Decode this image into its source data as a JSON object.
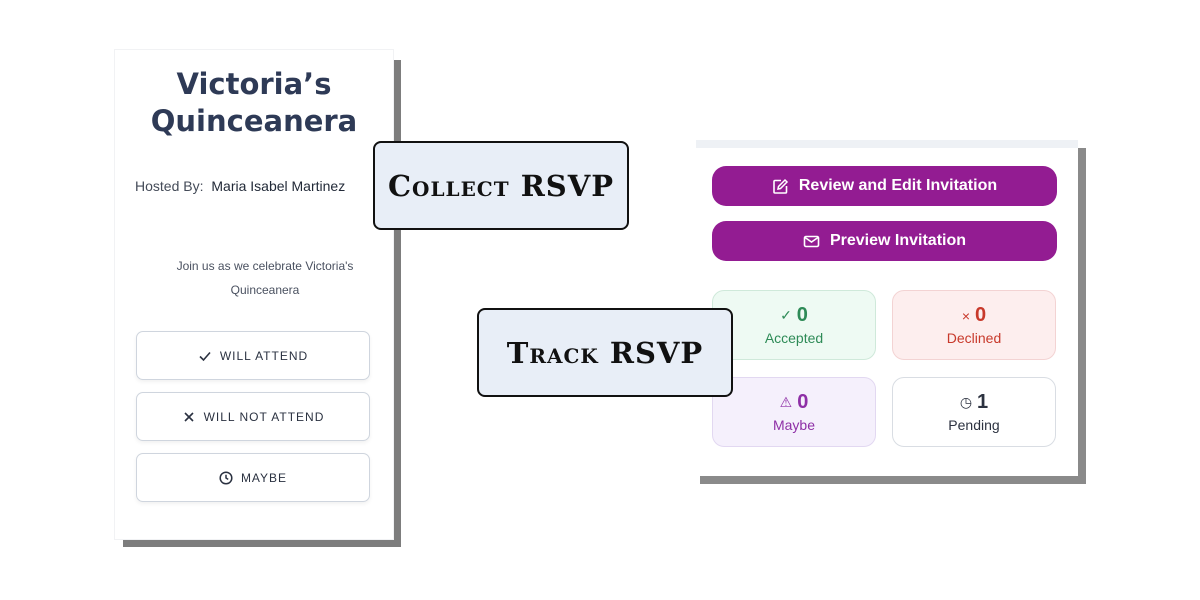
{
  "invitation": {
    "title": "Victoria’s\nQuinceanera",
    "hosted_by_label": "Hosted By:",
    "host_name": "Maria Isabel Martinez",
    "message": "Join us as we celebrate Victoria's Quinceanera",
    "buttons": [
      {
        "label": "WILL ATTEND",
        "icon": "check-icon"
      },
      {
        "label": "WILL NOT ATTEND",
        "icon": "x-icon"
      },
      {
        "label": "MAYBE",
        "icon": "clock-icon"
      }
    ]
  },
  "labels": {
    "collect": "Collect RSVP",
    "track": "Track RSVP"
  },
  "dashboard": {
    "actions": [
      {
        "label": "Review and Edit Invitation",
        "icon": "edit-icon"
      },
      {
        "label": "Preview Invitation",
        "icon": "mail-icon"
      }
    ],
    "stats": [
      {
        "symbol": "✓",
        "count": "0",
        "label": "Accepted",
        "icon": "check-icon",
        "color": "#2e8b57",
        "bg": "#eefaf3",
        "border": "#cfe9da"
      },
      {
        "symbol": "×",
        "count": "0",
        "label": "Declined",
        "icon": "x-icon",
        "color": "#c8392b",
        "bg": "#fdeeee",
        "border": "#f3d3d3"
      },
      {
        "symbol": "⚠",
        "count": "0",
        "label": "Maybe",
        "icon": "warning-icon",
        "color": "#8e2fa6",
        "bg": "#f5f0fc",
        "border": "#e2d8f1"
      },
      {
        "symbol": "◷",
        "count": "1",
        "label": "Pending",
        "icon": "clock-icon",
        "color": "#2c3240",
        "bg": "#ffffff",
        "border": "#d9dde3"
      }
    ],
    "accent_color": "#931c92"
  }
}
